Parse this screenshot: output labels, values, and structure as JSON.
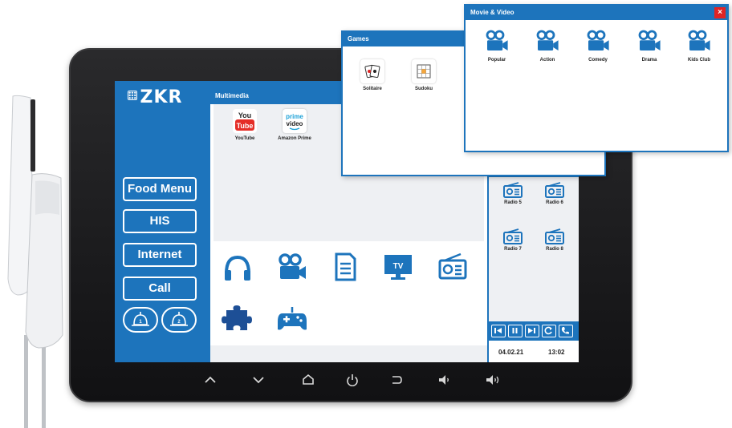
{
  "brand": {
    "name": "ZKR"
  },
  "sidebar": {
    "buttons": [
      {
        "label": "Food Menu"
      },
      {
        "label": "HIS"
      },
      {
        "label": "Internet"
      },
      {
        "label": "Call"
      }
    ],
    "nurse_call_labels": [
      "1",
      "2"
    ]
  },
  "multimedia": {
    "title": "Multimedia",
    "apps": [
      {
        "label": "YouTube",
        "icon": "youtube-icon",
        "icon_text_top": "You",
        "icon_text_bottom": "Tube"
      },
      {
        "label": "Amazon Prime",
        "icon": "prime-video-icon",
        "icon_text_top": "prime",
        "icon_text_bottom": "video"
      }
    ],
    "categories": [
      {
        "icon": "headphones-icon"
      },
      {
        "icon": "video-camera-icon"
      },
      {
        "icon": "document-icon"
      },
      {
        "icon": "tv-icon",
        "text": "TV"
      },
      {
        "icon": "radio-icon"
      },
      {
        "icon": "puzzle-icon"
      },
      {
        "icon": "gamepad-icon"
      }
    ]
  },
  "radio": {
    "stations": [
      {
        "label": "Radio 5"
      },
      {
        "label": "Radio 6"
      },
      {
        "label": "Radio 7"
      },
      {
        "label": "Radio 8"
      }
    ],
    "controls": [
      "skip-back-icon",
      "pause-icon",
      "skip-forward-icon",
      "refresh-icon",
      "phone-icon"
    ]
  },
  "status": {
    "date": "04.02.21",
    "time": "13:02"
  },
  "games": {
    "title": "Games",
    "items": [
      {
        "label": "Solitaire",
        "icon": "playing-cards-icon"
      },
      {
        "label": "Sudoku",
        "icon": "sudoku-grid-icon"
      }
    ]
  },
  "movies": {
    "title": "Movie & Video",
    "close_label": "×",
    "items": [
      {
        "label": "Popular"
      },
      {
        "label": "Action"
      },
      {
        "label": "Comedy"
      },
      {
        "label": "Drama"
      },
      {
        "label": "Kids Club"
      }
    ]
  },
  "hardware_keys": [
    "up-arrow-icon",
    "down-arrow-icon",
    "home-icon",
    "power-icon",
    "back-icon",
    "volume-down-icon",
    "volume-up-icon"
  ],
  "colors": {
    "accent": "#1d74bc",
    "close": "#e02424",
    "bezel": "#1a1a1c",
    "panel": "#eef0f3"
  }
}
